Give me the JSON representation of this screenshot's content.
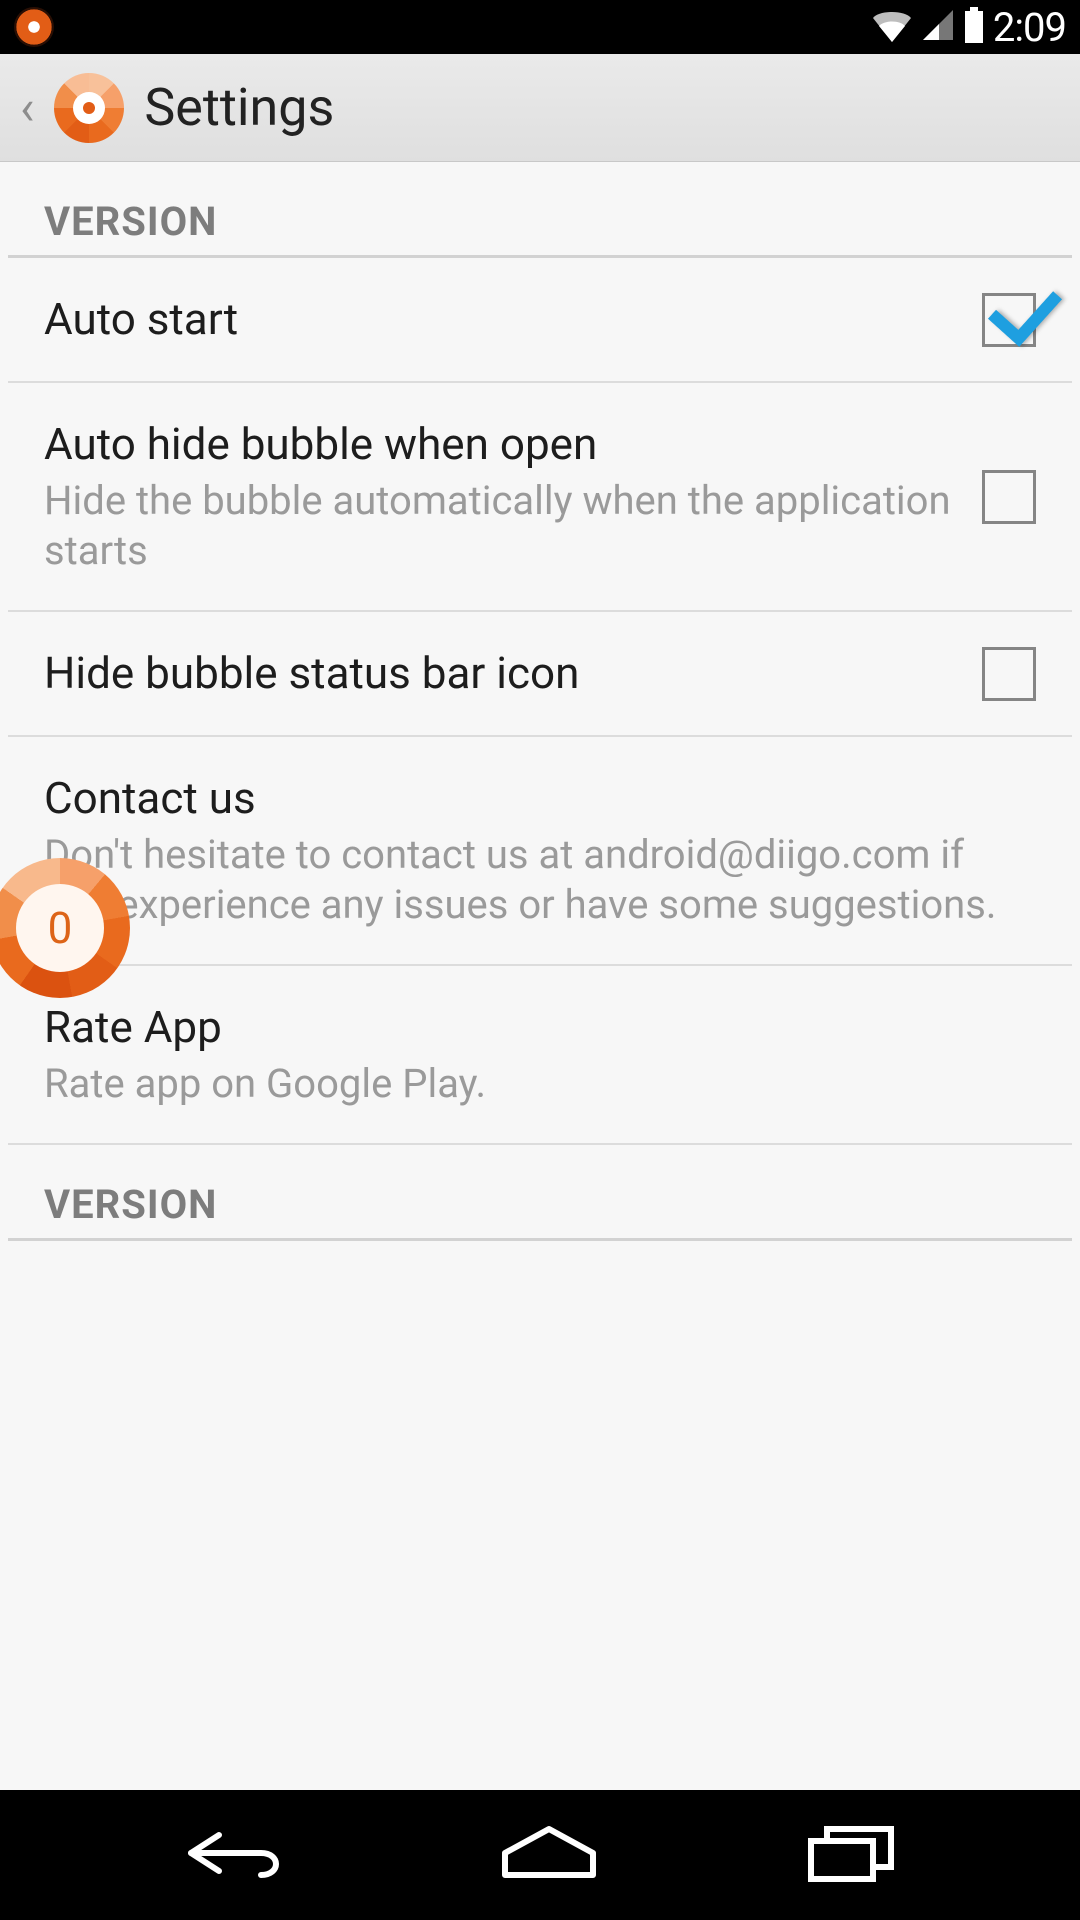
{
  "status": {
    "time": "2:09"
  },
  "header": {
    "title": "Settings"
  },
  "sections": {
    "version1": "VERSION",
    "version2": "VERSION"
  },
  "settings": {
    "autoStart": {
      "title": "Auto start",
      "checked": true
    },
    "autoHide": {
      "title": "Auto hide bubble when open",
      "sub": "Hide the bubble automatically when the application starts",
      "checked": false
    },
    "hideIcon": {
      "title": "Hide bubble status bar icon",
      "checked": false
    },
    "contact": {
      "title": "Contact us",
      "sub": "Don't hesitate to contact us at android@diigo.com if you experience any issues or have some suggestions."
    },
    "rate": {
      "title": "Rate App",
      "sub": "Rate app on Google Play."
    }
  },
  "bubble": {
    "count": "0"
  }
}
